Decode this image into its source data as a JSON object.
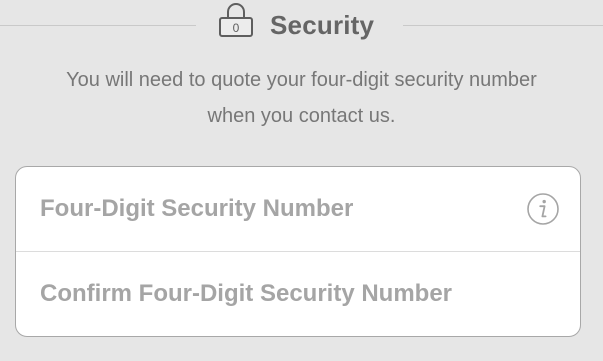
{
  "section": {
    "title": "Security",
    "icon": "lock-icon",
    "lock_digit": "0",
    "description": "You will need to quote your four-digit security number when you contact us."
  },
  "fields": {
    "security_number": {
      "placeholder": "Four-Digit Security Number",
      "value": "",
      "info_icon": "info-icon"
    },
    "confirm_security_number": {
      "placeholder": "Confirm Four-Digit Security Number",
      "value": ""
    }
  },
  "colors": {
    "background": "#e6e6e6",
    "card": "#ffffff",
    "placeholder": "#a5a5a5",
    "title": "#656565"
  }
}
